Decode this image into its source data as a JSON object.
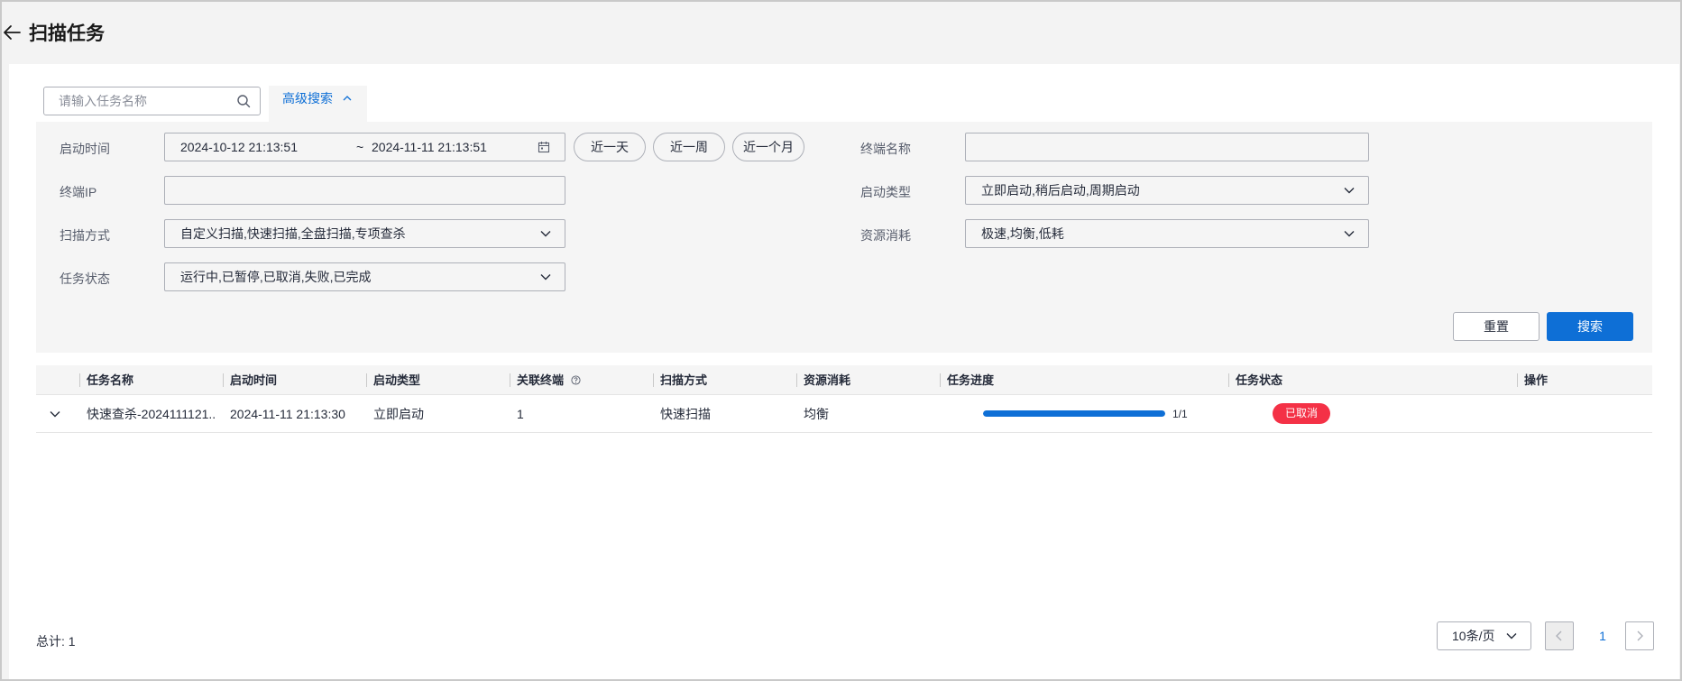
{
  "header": {
    "title": "扫描任务"
  },
  "search": {
    "placeholder": "请输入任务名称",
    "value": ""
  },
  "advanced": {
    "tab_label": "高级搜索"
  },
  "filters": {
    "start_time": {
      "label": "启动时间",
      "from": "2024-10-12 21:13:51",
      "sep": "~",
      "to": "2024-11-11 21:13:51"
    },
    "quick_ranges": [
      "近一天",
      "近一周",
      "近一个月"
    ],
    "terminal_name": {
      "label": "终端名称",
      "value": ""
    },
    "terminal_ip": {
      "label": "终端IP",
      "value": ""
    },
    "start_type": {
      "label": "启动类型",
      "value": "立即启动,稍后启动,周期启动"
    },
    "scan_method": {
      "label": "扫描方式",
      "value": "自定义扫描,快速扫描,全盘扫描,专项查杀"
    },
    "resource": {
      "label": "资源消耗",
      "value": "极速,均衡,低耗"
    },
    "task_status": {
      "label": "任务状态",
      "value": "运行中,已暂停,已取消,失败,已完成"
    },
    "reset_label": "重置",
    "search_label": "搜索"
  },
  "table": {
    "columns": [
      "任务名称",
      "启动时间",
      "启动类型",
      "关联终端",
      "扫描方式",
      "资源消耗",
      "任务进度",
      "任务状态",
      "操作"
    ],
    "rows": [
      {
        "name": "快速查杀-2024111121...",
        "start_time": "2024-11-11 21:13:30",
        "start_type": "立即启动",
        "terminals": "1",
        "scan_method": "快速扫描",
        "resource": "均衡",
        "progress": 1.0,
        "progress_text": "1/1",
        "status": "已取消",
        "status_color": "#f43146"
      }
    ]
  },
  "footer": {
    "total": "总计: 1",
    "page_size": "10条/页",
    "current_page": "1"
  },
  "colors": {
    "primary": "#0e6fd6",
    "danger": "#f43146"
  }
}
